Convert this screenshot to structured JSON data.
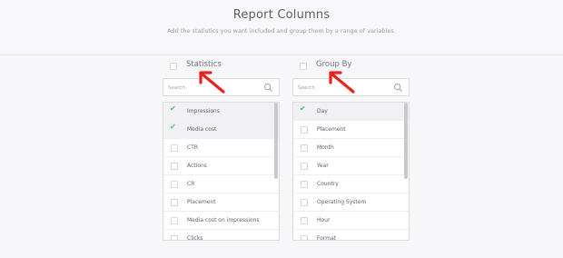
{
  "header": {
    "title": "Report Columns",
    "subtitle": "Add the statistics you want included and group them by a range of variables."
  },
  "statistics": {
    "title": "Statistics",
    "search_placeholder": "Search",
    "items": [
      {
        "label": "Impressions",
        "checked": true
      },
      {
        "label": "Media cost",
        "checked": true
      },
      {
        "label": "CTR",
        "checked": false
      },
      {
        "label": "Actions",
        "checked": false
      },
      {
        "label": "CR",
        "checked": false
      },
      {
        "label": "Placement",
        "checked": false
      },
      {
        "label": "Media cost on impressions",
        "checked": false
      },
      {
        "label": "Clicks",
        "checked": false
      }
    ]
  },
  "group_by": {
    "title": "Group By",
    "search_placeholder": "Search",
    "items": [
      {
        "label": "Day",
        "checked": true
      },
      {
        "label": "Placement",
        "checked": false
      },
      {
        "label": "Month",
        "checked": false
      },
      {
        "label": "Year",
        "checked": false
      },
      {
        "label": "Country",
        "checked": false
      },
      {
        "label": "Operating System",
        "checked": false
      },
      {
        "label": "Hour",
        "checked": false
      },
      {
        "label": "Format",
        "checked": false
      }
    ]
  },
  "colors": {
    "check": "#5cb85c",
    "annotation_arrow": "#e8231e"
  },
  "icons": {
    "search": "search-icon",
    "check": "checkmark-icon",
    "annotation": "red-arrow-icon"
  }
}
